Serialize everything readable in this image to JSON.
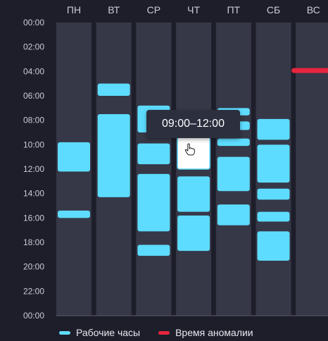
{
  "chart_data": {
    "type": "timeline",
    "days": [
      "ПН",
      "ВТ",
      "СР",
      "ЧТ",
      "ПТ",
      "СБ",
      "ВС"
    ],
    "y_ticks": [
      "00:00",
      "02:00",
      "04:00",
      "06:00",
      "08:00",
      "10:00",
      "12:00",
      "14:00",
      "16:00",
      "18:00",
      "20:00",
      "22:00",
      "00:00"
    ],
    "y_range_hours": [
      0,
      24
    ],
    "work_hours": [
      {
        "day": 0,
        "intervals": [
          [
            9.8,
            12.2
          ],
          [
            15.4,
            16.0
          ]
        ]
      },
      {
        "day": 1,
        "intervals": [
          [
            5.0,
            6.0
          ],
          [
            7.5,
            14.3
          ]
        ]
      },
      {
        "day": 2,
        "intervals": [
          [
            6.8,
            9.0
          ],
          [
            9.9,
            11.6
          ],
          [
            12.4,
            17.1
          ],
          [
            18.2,
            19.1
          ]
        ]
      },
      {
        "day": 3,
        "intervals": [
          [
            9.0,
            12.0
          ],
          [
            12.6,
            15.5
          ],
          [
            15.8,
            18.7
          ]
        ]
      },
      {
        "day": 4,
        "intervals": [
          [
            7.0,
            7.6
          ],
          [
            8.1,
            8.8
          ],
          [
            9.5,
            10.1
          ],
          [
            11.0,
            13.8
          ],
          [
            14.9,
            16.6
          ]
        ]
      },
      {
        "day": 5,
        "intervals": [
          [
            7.9,
            9.6
          ],
          [
            10.0,
            13.1
          ],
          [
            13.6,
            14.5
          ],
          [
            15.5,
            16.3
          ],
          [
            17.1,
            19.5
          ]
        ]
      }
    ],
    "anomalies": [
      {
        "day": 6,
        "intervals": [
          [
            3.9,
            3.9
          ]
        ]
      }
    ],
    "series_colors": {
      "work": "#5ddcff",
      "anomaly": "#e8263e"
    },
    "column_color": "#363847",
    "grid": false,
    "legend_position": "bottom",
    "highlight": {
      "day": 3,
      "interval": [
        9.0,
        12.0
      ]
    }
  },
  "legend": {
    "work_label": "Рабочие часы",
    "anomaly_label": "Время аномалии"
  },
  "tooltip": {
    "text": "09:00–12:00"
  },
  "cursor_icon": "pointing-hand"
}
